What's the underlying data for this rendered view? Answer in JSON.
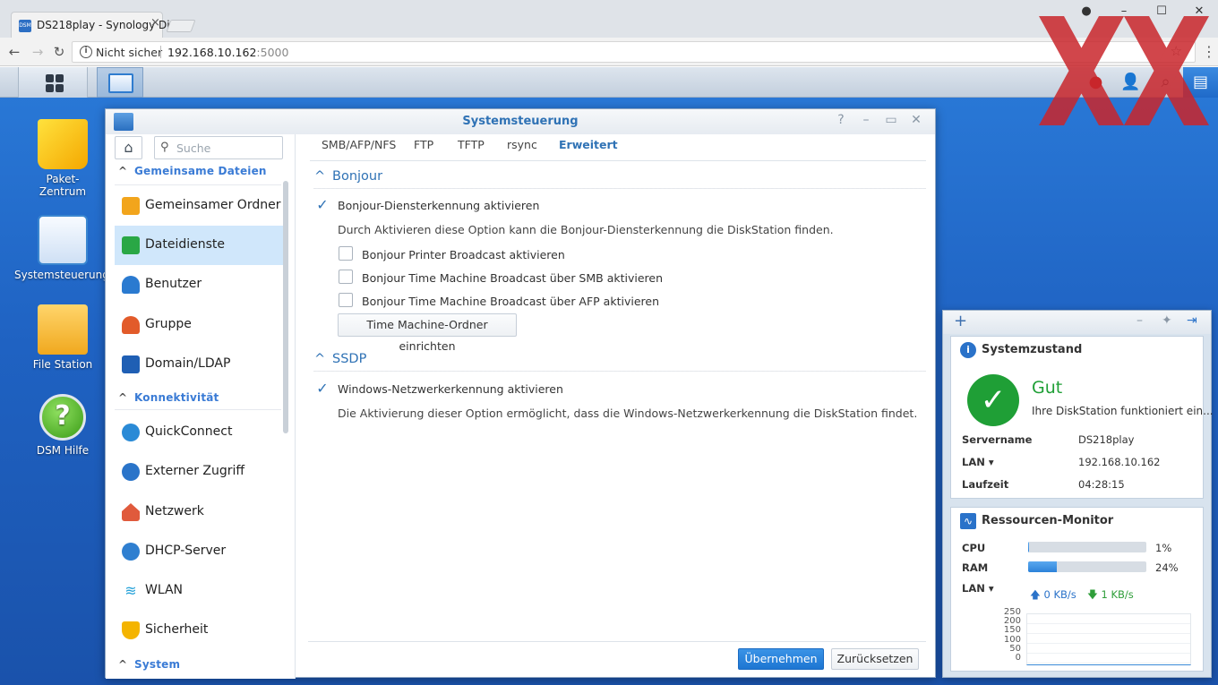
{
  "browser": {
    "tab_title": "DS218play - Synology Di",
    "tab_favicon": "DSM",
    "close_glyph": "×",
    "insecure_label": "Nicht sicher",
    "url_host": "192.168.10.162",
    "url_port": ":5000",
    "window_controls": [
      "minimize-icon",
      "maximize-icon",
      "close-icon"
    ]
  },
  "desktop": {
    "icons": [
      {
        "label_line1": "Paket-",
        "label_line2": "Zentrum"
      },
      {
        "label_line1": "Systemsteuerung",
        "label_line2": ""
      },
      {
        "label_line1": "File Station",
        "label_line2": ""
      },
      {
        "label_line1": "DSM Hilfe",
        "label_line2": ""
      }
    ]
  },
  "window": {
    "title": "Systemsteuerung",
    "search_placeholder": "Suche",
    "sections": {
      "files": "Gemeinsame Dateien",
      "connectivity": "Konnektivität",
      "system": "System"
    },
    "nav": [
      {
        "label": "Gemeinsamer Ordner",
        "icon": "folder-share-icon"
      },
      {
        "label": "Dateidienste",
        "icon": "file-services-icon",
        "selected": true
      },
      {
        "label": "Benutzer",
        "icon": "user-icon"
      },
      {
        "label": "Gruppe",
        "icon": "group-icon"
      },
      {
        "label": "Domain/LDAP",
        "icon": "domain-icon"
      },
      {
        "label": "QuickConnect",
        "icon": "quickconnect-icon"
      },
      {
        "label": "Externer Zugriff",
        "icon": "globe-icon"
      },
      {
        "label": "Netzwerk",
        "icon": "network-house-icon"
      },
      {
        "label": "DHCP-Server",
        "icon": "dhcp-icon"
      },
      {
        "label": "WLAN",
        "icon": "wifi-icon"
      },
      {
        "label": "Sicherheit",
        "icon": "shield-icon"
      }
    ],
    "tabs": [
      "SMB/AFP/NFS",
      "FTP",
      "TFTP",
      "rsync",
      "Erweitert"
    ],
    "active_tab": "Erweitert",
    "bonjour": {
      "title": "Bonjour",
      "enable_label": "Bonjour-Diensterkennung aktivieren",
      "enable_checked": true,
      "description": "Durch Aktivieren diese Option kann die Bonjour-Diensterkennung die DiskStation finden.",
      "printer_label": "Bonjour Printer Broadcast aktivieren",
      "printer_checked": false,
      "tm_smb_label": "Bonjour Time Machine Broadcast über SMB aktivieren",
      "tm_smb_checked": false,
      "tm_afp_label": "Bonjour Time Machine Broadcast über AFP aktivieren",
      "tm_afp_checked": false,
      "tm_button": "Time Machine-Ordner einrichten"
    },
    "ssdp": {
      "title": "SSDP",
      "enable_label": "Windows-Netzwerkerkennung aktivieren",
      "enable_checked": true,
      "description": "Die Aktivierung dieser Option ermöglicht, dass die Windows-Netzwerkerkennung die DiskStation findet."
    },
    "apply_button": "Übernehmen",
    "reset_button": "Zurücksetzen"
  },
  "widget": {
    "health": {
      "title": "Systemzustand",
      "status": "Gut",
      "status_desc": "Ihre DiskStation funktioniert ein...",
      "rows": [
        {
          "key": "Servername",
          "value": "DS218play"
        },
        {
          "key": "LAN ▾",
          "value": "192.168.10.162"
        },
        {
          "key": "Laufzeit",
          "value": "04:28:15"
        }
      ]
    },
    "resource": {
      "title": "Ressourcen-Monitor",
      "cpu_label": "CPU",
      "cpu_pct": 1,
      "cpu_text": "1%",
      "ram_label": "RAM",
      "ram_pct": 24,
      "ram_text": "24%",
      "lan_label": "LAN ▾",
      "up": "0 KB/s",
      "down": "1 KB/s",
      "y_ticks": [
        "250",
        "200",
        "150",
        "100",
        "50",
        "0"
      ]
    }
  },
  "colors": {
    "accent": "#2f72b5",
    "ok_green": "#1f9f36",
    "selected_bg": "#d0e7fb",
    "apply_blue": "#1d76d2"
  }
}
